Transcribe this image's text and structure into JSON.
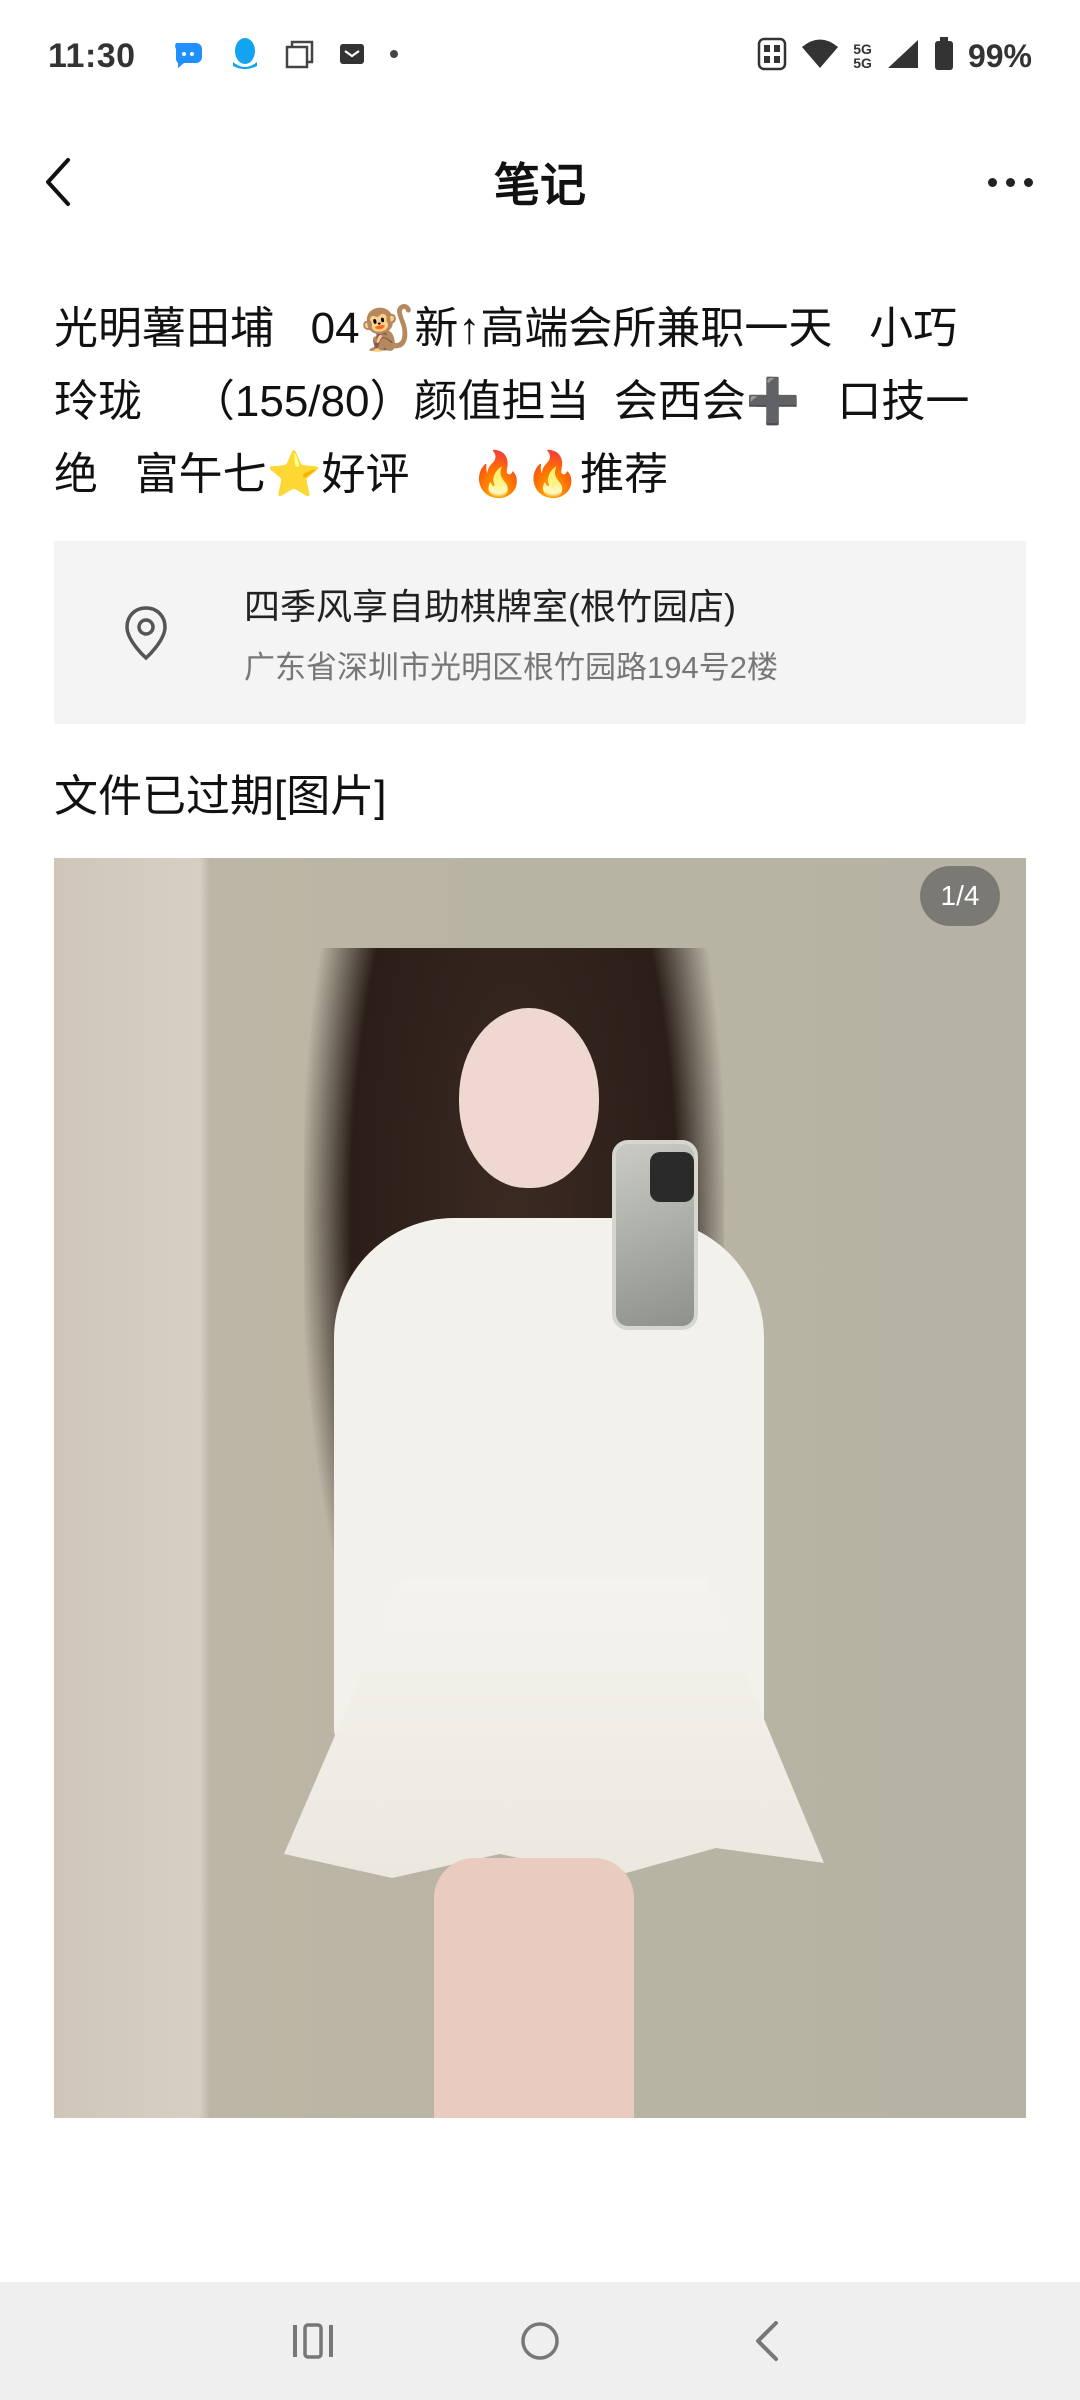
{
  "status_bar": {
    "time": "11:30",
    "network_top": "5G",
    "network_bottom": "5G",
    "battery": "99%",
    "icons": [
      "message-icon",
      "qq-icon",
      "copy-icon",
      "mail-icon",
      "dot-icon",
      "nfc-icon",
      "wifi-icon",
      "signal-icon",
      "battery-icon"
    ]
  },
  "header": {
    "title": "笔记",
    "back_icon": "chevron-left-icon",
    "more_icon": "more-dots-icon"
  },
  "post": {
    "title": "光明薯田埔   04🐒新↑高端会所兼职一天   小巧\n玲珑    （155/80）颜值担当  会西会➕   口技一\n绝   富午七⭐好评     🔥🔥推荐",
    "location": {
      "name": "四季风享自助棋牌室(根竹园店)",
      "address": "广东省深圳市光明区根竹园路194号2楼",
      "icon": "location-pin-icon"
    },
    "content_text": "文件已过期[图片]",
    "image": {
      "page_indicator": "1/4",
      "current": 1,
      "total": 4
    }
  },
  "system_nav": {
    "buttons": [
      "recent-apps-icon",
      "home-icon",
      "back-icon"
    ]
  }
}
